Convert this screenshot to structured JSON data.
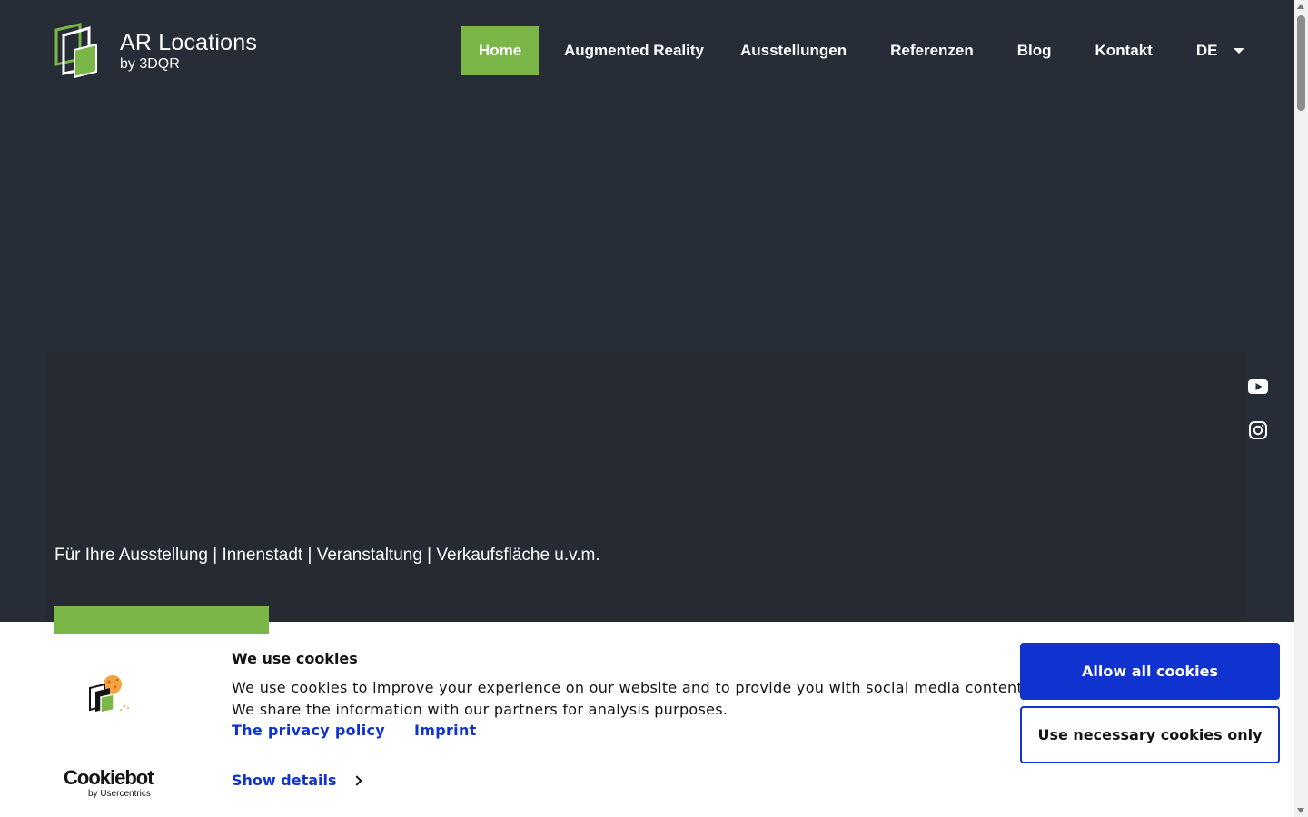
{
  "brand": {
    "title": "AR Locations",
    "subtitle": "by 3DQR",
    "accent_color": "#7ab648",
    "background_color": "#272d36"
  },
  "nav": {
    "items": [
      {
        "label": "Home",
        "active": true
      },
      {
        "label": "Augmented Reality"
      },
      {
        "label": "Ausstellungen"
      },
      {
        "label": "Referenzen"
      },
      {
        "label": "Blog"
      },
      {
        "label": "Kontakt"
      }
    ],
    "language": "DE"
  },
  "hero": {
    "subtitle": "Für Ihre Ausstellung | Innenstadt | Veranstaltung | Verkaufsfläche u.v.m."
  },
  "social": {
    "icons": [
      "youtube-icon",
      "instagram-icon"
    ]
  },
  "cookie_banner": {
    "title": "We use cookies",
    "text_line1": "We use cookies to improve your experience on our website and to provide you with social media content.",
    "text_line2": "We share the information with our partners for analysis purposes.",
    "privacy_link": "The privacy policy",
    "imprint_link": "Imprint",
    "show_details": "Show details",
    "allow_all_label": "Allow all cookies",
    "necessary_only_label": "Use necessary cookies only",
    "provider_name": "Cookiebot",
    "provider_sub": "by Usercentrics",
    "button_color": "#1032cf"
  }
}
